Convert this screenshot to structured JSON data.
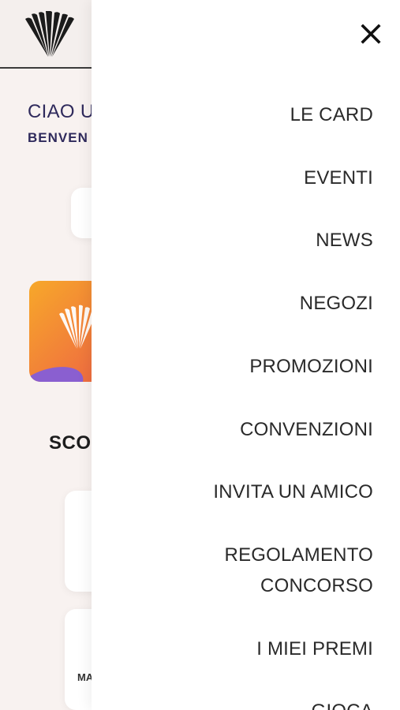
{
  "background": {
    "greeting": "CIAO U",
    "welcome": "BENVEN",
    "section_title": "SCO",
    "small_label": "MA"
  },
  "drawer": {
    "close_icon": "close-icon",
    "menu_items": [
      {
        "label": "LE CARD"
      },
      {
        "label": "EVENTI"
      },
      {
        "label": "NEWS"
      },
      {
        "label": "NEGOZI"
      },
      {
        "label": "PROMOZIONI"
      },
      {
        "label": "CONVENZIONI"
      },
      {
        "label": "INVITA UN AMICO"
      },
      {
        "label": "REGOLAMENTO\nCONCORSO"
      },
      {
        "label": "I MIEI PREMI"
      },
      {
        "label": "GIOCA"
      }
    ]
  },
  "colors": {
    "primary_text": "#2f2a5c",
    "menu_text": "#2a2a2a",
    "card_gradient_start": "#f7a82a",
    "card_gradient_end": "#e8543c",
    "card_accent": "#8a5fd0"
  }
}
